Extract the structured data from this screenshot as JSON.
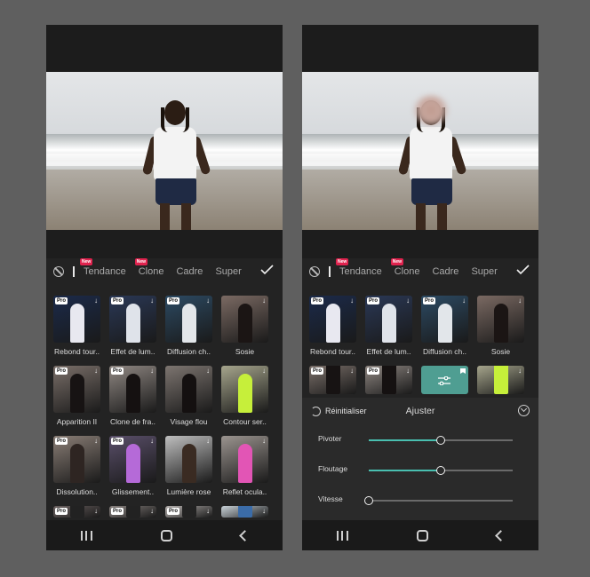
{
  "left": {
    "tabs": [
      {
        "label": "Tendance",
        "badge": "New",
        "active": true
      },
      {
        "label": "Clone",
        "badge": "New",
        "active": false
      },
      {
        "label": "Cadre",
        "badge": "",
        "active": false
      },
      {
        "label": "Super",
        "badge": "",
        "active": false
      }
    ],
    "effects": [
      {
        "label": "Rebond tour..",
        "pro": "Pro",
        "download": true,
        "bg": "#1b2a4a",
        "fig": "#e8e8f0"
      },
      {
        "label": "Effet de lum..",
        "pro": "Pro",
        "download": true,
        "bg": "#2a3856",
        "fig": "#dfe3ea"
      },
      {
        "label": "Diffusion ch..",
        "pro": "Pro",
        "download": true,
        "bg": "#2c4a63",
        "fig": "#e2e6ea"
      },
      {
        "label": "Sosie",
        "pro": "",
        "download": true,
        "bg": "#7b6a63",
        "fig": "#1b1514"
      },
      {
        "label": "Apparition II",
        "pro": "Pro",
        "download": true,
        "bg": "#7a6f69",
        "fig": "#171313"
      },
      {
        "label": "Clone de fra..",
        "pro": "Pro",
        "download": true,
        "bg": "#8f8782",
        "fig": "#151111"
      },
      {
        "label": "Visage flou",
        "pro": "",
        "download": true,
        "bg": "#7d7570",
        "fig": "#141010"
      },
      {
        "label": "Contour ser..",
        "pro": "",
        "download": true,
        "bg": "#a6a58c",
        "fig": "#c6ef3a"
      },
      {
        "label": "Dissolution..",
        "pro": "Pro",
        "download": true,
        "bg": "#8a7e76",
        "fig": "#2e2522"
      },
      {
        "label": "Glissement..",
        "pro": "Pro",
        "download": true,
        "bg": "#5a4f6a",
        "fig": "#b56ad8"
      },
      {
        "label": "Lumière rose",
        "pro": "",
        "download": true,
        "bg": "#bfbfbf",
        "fig": "#3a2b22"
      },
      {
        "label": "Reflet ocula..",
        "pro": "",
        "download": true,
        "bg": "#9b948f",
        "fig": "#e255b5"
      },
      {
        "label": "",
        "pro": "Pro",
        "download": true,
        "bg": "#6c6261",
        "fig": "#222"
      },
      {
        "label": "",
        "pro": "Pro",
        "download": true,
        "bg": "#8a8380",
        "fig": "#222"
      },
      {
        "label": "",
        "pro": "Pro",
        "download": true,
        "bg": "#b7b2b0",
        "fig": "#222"
      },
      {
        "label": "",
        "pro": "",
        "download": true,
        "bg": "#c9d2d8",
        "fig": "#3b6ca8"
      }
    ]
  },
  "right": {
    "tabs": [
      {
        "label": "Tendance",
        "badge": "New",
        "active": true
      },
      {
        "label": "Clone",
        "badge": "New",
        "active": false
      },
      {
        "label": "Cadre",
        "badge": "",
        "active": false
      },
      {
        "label": "Super",
        "badge": "",
        "active": false
      }
    ],
    "effects": [
      {
        "label": "Rebond tour..",
        "pro": "Pro",
        "download": true,
        "bg": "#1b2a4a",
        "fig": "#e8e8f0"
      },
      {
        "label": "Effet de lum..",
        "pro": "Pro",
        "download": true,
        "bg": "#2a3856",
        "fig": "#dfe3ea"
      },
      {
        "label": "Diffusion ch..",
        "pro": "Pro",
        "download": true,
        "bg": "#2c4a63",
        "fig": "#e2e6ea"
      },
      {
        "label": "Sosie",
        "pro": "",
        "download": true,
        "bg": "#7b6a63",
        "fig": "#1b1514"
      }
    ],
    "effects_row2": [
      {
        "pro": "Pro",
        "download": true,
        "bg": "#7a6f69",
        "fig": "#171313",
        "selected": false
      },
      {
        "pro": "Pro",
        "download": true,
        "bg": "#8f8782",
        "fig": "#151111",
        "selected": false
      },
      {
        "pro": "",
        "download": false,
        "bg": "#4f9e92",
        "fig": "",
        "selected": true
      },
      {
        "pro": "",
        "download": true,
        "bg": "#a6a58c",
        "fig": "#c6ef3a",
        "selected": false
      }
    ],
    "panel": {
      "reset_label": "Réinitialiser",
      "title": "Ajuster",
      "sliders": [
        {
          "label": "Pivoter",
          "value": 0.5
        },
        {
          "label": "Floutage",
          "value": 0.5
        },
        {
          "label": "Vitesse",
          "value": 0.0
        }
      ]
    }
  },
  "colors": {
    "accent": "#49bfb0",
    "badge": "#e0234e",
    "background": "#5f5f5f",
    "panel": "#2a2a2a"
  }
}
